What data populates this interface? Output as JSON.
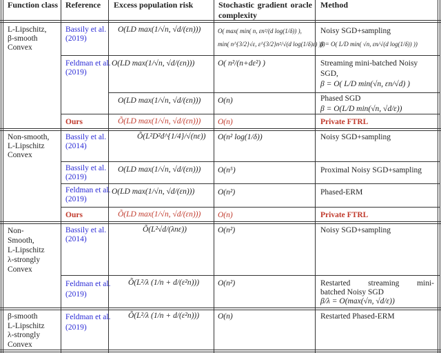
{
  "table": {
    "headers": {
      "function_class": "Function class",
      "reference": "Reference",
      "excess_risk": "Excess population risk",
      "oracle_complexity": "Stochastic gradient oracle complexity",
      "method": "Method"
    },
    "groups": [
      {
        "function_class": [
          "L-Lipschitz,",
          "β-smooth",
          "Convex"
        ],
        "rows": [
          {
            "reference": [
              "Bassily et al.",
              "(2019)"
            ],
            "ref_color": "blue",
            "risk": "O(LD max(1/√n, √d/(εn)))",
            "complexity": [
              "O( max( min( n, εn²/(d log(1/δ)) ),",
              "min( n^{3/2}√ε, ε^{3/2}n²/√(d log(1/δ)ε) )))"
            ],
            "method": [
              "Noisy SGD+sampling",
              "β = O( L/D min( √n, εn/√(d log(1/δ)) ))"
            ]
          },
          {
            "reference": [
              "Feldman et al.",
              "(2019)"
            ],
            "ref_color": "blue",
            "risk": "O(LD max(1/√n, √d/(εn)))",
            "complexity": [
              "O( n²/(n+dε²) )"
            ],
            "method": [
              "Streaming mini-batched Noisy",
              "SGD,",
              "β = O( L/D min(√n, εn/√d) )"
            ]
          },
          {
            "reference": [],
            "ref_color": "blue",
            "risk": "O(LD max(1/√n, √d/(εn)))",
            "complexity": [
              "O(n)"
            ],
            "method": [
              "Phased SGD",
              "β = O(L/D min(√n, √d/ε))"
            ]
          },
          {
            "reference": [
              "Ours"
            ],
            "ref_color": "red",
            "risk": "Õ(LD max(1/√n, √d/(εn)))",
            "complexity": [
              "O(n)"
            ],
            "method": [
              "Private FTRL"
            ],
            "highlight": true
          }
        ]
      },
      {
        "function_class": [
          "Non-smooth,",
          "L-Lipschitz",
          "Convex"
        ],
        "rows": [
          {
            "reference": [
              "Bassily et al.",
              "(2014)"
            ],
            "ref_color": "blue",
            "risk": "Õ(L²D²d^{1/4}/√(nε))",
            "complexity": [
              "O(n² log(1/δ))"
            ],
            "method": [
              "Noisy SGD+sampling"
            ]
          },
          {
            "reference": [
              "Bassily et al.",
              "(2019)"
            ],
            "ref_color": "blue",
            "risk": "O(LD max(1/√n, √d/(εn)))",
            "complexity": [
              "O(n⁵)"
            ],
            "method": [
              "Proximal Noisy SGD+sampling"
            ]
          },
          {
            "reference": [
              "Feldman et al.",
              "(2019)"
            ],
            "ref_color": "blue",
            "risk": "O(LD max(1/√n, √d/(εn)))",
            "complexity": [
              "O(n²)"
            ],
            "method": [
              "Phased-ERM"
            ]
          },
          {
            "reference": [
              "Ours"
            ],
            "ref_color": "red",
            "risk": "Õ(LD max(1/√n, √d/(εn)))",
            "complexity": [
              "O(n)"
            ],
            "method": [
              "Private FTRL"
            ],
            "highlight": true
          }
        ]
      },
      {
        "function_class": [
          "Non-",
          "Smooth,",
          "L-Lipschitz",
          "λ-strongly",
          "Convex"
        ],
        "rows": [
          {
            "reference": [
              "Bassily et al.",
              "(2014)"
            ],
            "ref_color": "blue",
            "risk": "Õ(L²√d/(λnε))",
            "complexity": [
              "O(n²)"
            ],
            "method": [
              "Noisy SGD+sampling"
            ]
          },
          {
            "reference": [
              "Feldman et al.",
              "(2019)"
            ],
            "ref_color": "blue",
            "risk": "Õ(L²/λ (1/n + d/(ε²n)))",
            "complexity": [
              "O(n²)"
            ],
            "method": [
              "Restarted streaming mini-",
              "batched Noisy SGD",
              "β/λ = O(max(√n, √d/ε))"
            ]
          }
        ]
      },
      {
        "function_class": [
          "β-smooth",
          "L-Lipschitz",
          "λ-strongly",
          "Convex"
        ],
        "rows": [
          {
            "reference": [
              "Feldman et al.",
              "(2019)"
            ],
            "ref_color": "blue",
            "risk": "Õ(L²/λ (1/n + d/(ε²n)))",
            "complexity": [
              "O(n)"
            ],
            "method": [
              "Restarted Phased-ERM"
            ]
          }
        ]
      }
    ]
  },
  "colors": {
    "link_blue": "#2b2bd6",
    "ours_red": "#c0392b",
    "text": "#222222",
    "rule": "#333333"
  }
}
